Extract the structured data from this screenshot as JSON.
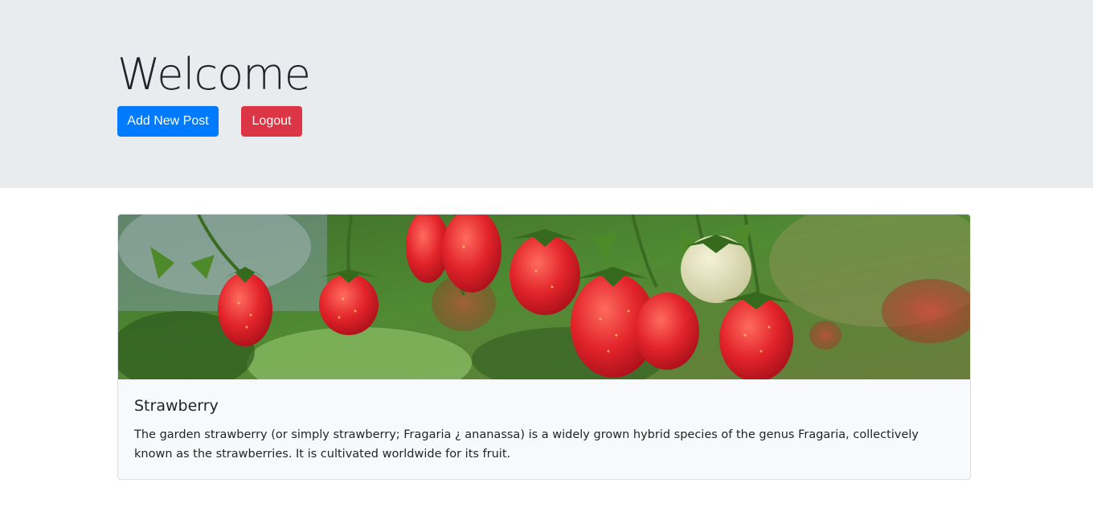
{
  "header": {
    "title": "Welcome",
    "add_post_label": "Add New Post",
    "logout_label": "Logout"
  },
  "post": {
    "title": "Strawberry",
    "body": "The garden strawberry (or simply strawberry; Fragaria ¿ ananassa) is a widely grown hybrid species of the genus Fragaria, collectively known as the strawberries. It is cultivated worldwide for its fruit.",
    "image": "strawberry-photo"
  },
  "colors": {
    "header_bg": "#e9ecef",
    "primary": "#007bff",
    "danger": "#dc3545",
    "card_bg": "#f8f9fa"
  }
}
